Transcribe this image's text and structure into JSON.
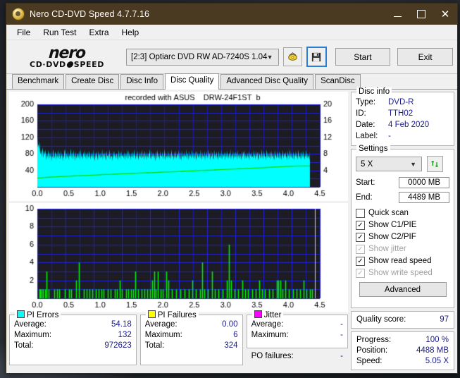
{
  "window": {
    "title": "Nero CD-DVD Speed 4.7.7.16",
    "icon": "nero-disc-icon",
    "minimize": "minimize-icon",
    "maximize": "maximize-icon",
    "close": "close-icon",
    "titlebar_color": "#4b3a22"
  },
  "menu": [
    "File",
    "Run Test",
    "Extra",
    "Help"
  ],
  "logo": {
    "line1": "nero",
    "line2a": "CD·DVD",
    "line2b": "SPEED"
  },
  "toolbar": {
    "drive": "[2:3]   Optiarc DVD RW AD-7240S 1.04",
    "eject_icon": "eject-disc-icon",
    "save_icon": "save-floppy-icon",
    "start_label": "Start",
    "exit_label": "Exit"
  },
  "tabs": [
    {
      "label": "Benchmark",
      "active": false
    },
    {
      "label": "Create Disc",
      "active": false
    },
    {
      "label": "Disc Info",
      "active": false
    },
    {
      "label": "Disc Quality",
      "active": true
    },
    {
      "label": "Advanced Disc Quality",
      "active": false
    },
    {
      "label": "ScanDisc",
      "active": false
    }
  ],
  "disc_info": {
    "legend": "Disc info",
    "rows": [
      {
        "key": "Type:",
        "value": "DVD-R"
      },
      {
        "key": "ID:",
        "value": "TTH02"
      },
      {
        "key": "Date:",
        "value": "4 Feb 2020"
      },
      {
        "key": "Label:",
        "value": "-"
      }
    ]
  },
  "settings": {
    "legend": "Settings",
    "speed": "5 X",
    "refresh_icon": "refresh-icon",
    "start_label": "Start:",
    "start_value": "0000 MB",
    "end_label": "End:",
    "end_value": "4489 MB",
    "checks": [
      {
        "label": "Quick scan",
        "checked": false,
        "disabled": false
      },
      {
        "label": "Show C1/PIE",
        "checked": true,
        "disabled": false
      },
      {
        "label": "Show C2/PIF",
        "checked": true,
        "disabled": false
      },
      {
        "label": "Show jitter",
        "checked": true,
        "disabled": true
      },
      {
        "label": "Show read speed",
        "checked": true,
        "disabled": false
      },
      {
        "label": "Show write speed",
        "checked": true,
        "disabled": true
      }
    ],
    "advanced_label": "Advanced"
  },
  "quality": {
    "label": "Quality score:",
    "value": "97"
  },
  "progress": {
    "rows": [
      {
        "key": "Progress:",
        "value": "100 %"
      },
      {
        "key": "Position:",
        "value": "4488 MB"
      },
      {
        "key": "Speed:",
        "value": "5.05 X"
      }
    ]
  },
  "stats": {
    "pi_errors": {
      "legend": "PI Errors",
      "color": "#00ffff",
      "rows": [
        {
          "key": "Average:",
          "value": "54.18"
        },
        {
          "key": "Maximum:",
          "value": "132"
        },
        {
          "key": "Total:",
          "value": "972623"
        }
      ]
    },
    "pi_failures": {
      "legend": "PI Failures",
      "color": "#ffff00",
      "rows": [
        {
          "key": "Average:",
          "value": "0.00"
        },
        {
          "key": "Maximum:",
          "value": "6"
        },
        {
          "key": "Total:",
          "value": "324"
        }
      ]
    },
    "jitter": {
      "legend": "Jitter",
      "color": "#ff00ff",
      "rows": [
        {
          "key": "Average:",
          "value": "-"
        },
        {
          "key": "Maximum:",
          "value": "-"
        }
      ],
      "po_label": "PO failures:",
      "po_value": "-"
    }
  },
  "chart_data": [
    {
      "type": "area",
      "name": "pi-errors-chart",
      "title": "recorded with ASUS    DRW-24F1ST  b",
      "xlabel": "",
      "ylabel": "",
      "xlim": [
        0.0,
        4.5
      ],
      "xticks": [
        "0.0",
        "0.5",
        "1.0",
        "1.5",
        "2.0",
        "2.5",
        "3.0",
        "3.5",
        "4.0",
        "4.5"
      ],
      "ylim": [
        0,
        200
      ],
      "yticks": [
        "200",
        "160",
        "120",
        "80",
        "40"
      ],
      "y2lim": [
        0,
        20
      ],
      "y2ticks": [
        "20",
        "16",
        "12",
        "8",
        "4"
      ],
      "grid": true,
      "plot_bg": "#1c1c22",
      "series": [
        {
          "name": "PI Errors",
          "color": "#00ffff",
          "axis": "left",
          "values": [
            120,
            96,
            104,
            92,
            110,
            86,
            78,
            90,
            72,
            84,
            96,
            70,
            80,
            88,
            76,
            92,
            64,
            74,
            82,
            70,
            90,
            78,
            66,
            84,
            72,
            88,
            62,
            76,
            70,
            92,
            80,
            68,
            74,
            86,
            78,
            64,
            82,
            70,
            90,
            76,
            68,
            84,
            72,
            66,
            88,
            74,
            80,
            62,
            78,
            70,
            86,
            92,
            74,
            66,
            82,
            76,
            70,
            88,
            64,
            80,
            72,
            78,
            94,
            68,
            84,
            76,
            66,
            90,
            72,
            80,
            62,
            86,
            74,
            68,
            82,
            78,
            70,
            88,
            76,
            64,
            92,
            70,
            80,
            74,
            66,
            84,
            78,
            72,
            90,
            68,
            76,
            82,
            64,
            86,
            74,
            70,
            88,
            78,
            66,
            80,
            72,
            84,
            76,
            68,
            90,
            74,
            62,
            82,
            70,
            86,
            78,
            72,
            64,
            88,
            76,
            80,
            68,
            84,
            70,
            74,
            92,
            66,
            78,
            82,
            72,
            86,
            70,
            64,
            88,
            76,
            74,
            80,
            68,
            90,
            78,
            66,
            84,
            72,
            76,
            62,
            86,
            70,
            88,
            74,
            80,
            68,
            78,
            82,
            72,
            64,
            90,
            76,
            70,
            84,
            66,
            88,
            74,
            78,
            72,
            80,
            68,
            86,
            64,
            76,
            82,
            70,
            90,
            74,
            66,
            88,
            78,
            72,
            80,
            64,
            84,
            70,
            76,
            86,
            68,
            92,
            74,
            78,
            66,
            82,
            70,
            88,
            76,
            64,
            80,
            72,
            86,
            74,
            68,
            90,
            78,
            70,
            84,
            66,
            76,
            88,
            72,
            80,
            64,
            86,
            74,
            70,
            82,
            78,
            92,
            68,
            76,
            66,
            88,
            72,
            84,
            70,
            80,
            74,
            62,
            86,
            78,
            68,
            90,
            76,
            70,
            82,
            64,
            88,
            74,
            78,
            72,
            86,
            66,
            80,
            70,
            92,
            76,
            64,
            84,
            72,
            78,
            68,
            88,
            74,
            70,
            82,
            76,
            66,
            90,
            78,
            72,
            80,
            64,
            86,
            70,
            74,
            88,
            68,
            76,
            82,
            72,
            90,
            66,
            78,
            84,
            70,
            64,
            88,
            76,
            72,
            80,
            68,
            86,
            74,
            78,
            70,
            92,
            66,
            82,
            76,
            64,
            88,
            72,
            80,
            74,
            68,
            90,
            78,
            70,
            84,
            66,
            76,
            86,
            72,
            64,
            88,
            80,
            74,
            70,
            82,
            78,
            68,
            90,
            76,
            66,
            84,
            72,
            78,
            70,
            88,
            64,
            80,
            74,
            86,
            68,
            76,
            92,
            70,
            82,
            78,
            64,
            88,
            72,
            76,
            84,
            70,
            66,
            90,
            74,
            80,
            68,
            86,
            78,
            72,
            64,
            88,
            76,
            70,
            82,
            74,
            68,
            90,
            66,
            80,
            78,
            72,
            86,
            64,
            76,
            84,
            70,
            88,
            74,
            68,
            78,
            82,
            70,
            92,
            66,
            76,
            80,
            72,
            88,
            64,
            84,
            74,
            70,
            86,
            78,
            66,
            90,
            72,
            80,
            68,
            76,
            82,
            74,
            64,
            88,
            70,
            78,
            86,
            72,
            90,
            66,
            80,
            74,
            68,
            84,
            76,
            70,
            88,
            64,
            82,
            78,
            72,
            86,
            70,
            76,
            68,
            90,
            74,
            80,
            66,
            88,
            72,
            78,
            84,
            70,
            64,
            86,
            76,
            80,
            68,
            74,
            92,
            70,
            82,
            66,
            88,
            78,
            72,
            76,
            64,
            90,
            80,
            68,
            84,
            74,
            70,
            86,
            78,
            66,
            88,
            72,
            76,
            82,
            70,
            64,
            90,
            74,
            80,
            68,
            78,
            86,
            72,
            70,
            88,
            66,
            84,
            76,
            64,
            80,
            74,
            90,
            68,
            78,
            82,
            72,
            86,
            70,
            76,
            64,
            88,
            74,
            80,
            66,
            92,
            78,
            70,
            84,
            72,
            68,
            86,
            76,
            64,
            80,
            74,
            88,
            70,
            82,
            66,
            78,
            90,
            72,
            76,
            68,
            84,
            64,
            86,
            78,
            70,
            88,
            74,
            66,
            80,
            72,
            90,
            76,
            68,
            82,
            70,
            78,
            64,
            86
          ]
        },
        {
          "name": "Read speed",
          "color": "#00e000",
          "axis": "right",
          "values": [
            2.1,
            2.2,
            2.3,
            2.35,
            2.4,
            2.45,
            2.5,
            2.55,
            2.6,
            2.65,
            2.7,
            2.72,
            2.75,
            2.8,
            2.85,
            2.9,
            2.95,
            3.0,
            3.02,
            3.05,
            3.1,
            3.15,
            3.2,
            3.22,
            3.25,
            3.3,
            3.35,
            3.4,
            3.42,
            3.45,
            3.5,
            3.55,
            3.6,
            3.62,
            3.65,
            3.7,
            3.75,
            3.8,
            3.82,
            3.85,
            3.9,
            3.95,
            4.0,
            4.02,
            4.05,
            4.1,
            4.15,
            4.2,
            4.25,
            4.3,
            4.35,
            4.4,
            4.42,
            4.45,
            4.5,
            4.55,
            4.6,
            4.65,
            4.7,
            4.75,
            4.8,
            4.85,
            4.9,
            4.95,
            5.0,
            5.02,
            5.05,
            5.05,
            5.05,
            5.05
          ]
        }
      ]
    },
    {
      "type": "bar",
      "name": "pi-failures-chart",
      "xlim": [
        0.0,
        4.5
      ],
      "xticks": [
        "0.0",
        "0.5",
        "1.0",
        "1.5",
        "2.0",
        "2.5",
        "3.0",
        "3.5",
        "4.0",
        "4.5"
      ],
      "ylim": [
        0,
        10
      ],
      "yticks": [
        "10",
        "8",
        "6",
        "4",
        "2"
      ],
      "grid": true,
      "plot_bg": "#1c1c22",
      "bar_color": "#00ee00",
      "points": [
        [
          0.03,
          1
        ],
        [
          0.05,
          1
        ],
        [
          0.07,
          1
        ],
        [
          0.09,
          1
        ],
        [
          0.12,
          1
        ],
        [
          0.15,
          3
        ],
        [
          0.18,
          1
        ],
        [
          0.27,
          1
        ],
        [
          0.31,
          1
        ],
        [
          0.35,
          1
        ],
        [
          0.44,
          1
        ],
        [
          0.5,
          1
        ],
        [
          0.54,
          1
        ],
        [
          0.62,
          2
        ],
        [
          0.66,
          4
        ],
        [
          0.74,
          1
        ],
        [
          0.79,
          1
        ],
        [
          0.83,
          1
        ],
        [
          0.87,
          1
        ],
        [
          0.93,
          1
        ],
        [
          0.98,
          1
        ],
        [
          1.02,
          1
        ],
        [
          1.06,
          1
        ],
        [
          1.12,
          1
        ],
        [
          1.17,
          1
        ],
        [
          1.23,
          1
        ],
        [
          1.27,
          1
        ],
        [
          1.31,
          2
        ],
        [
          1.35,
          1
        ],
        [
          1.41,
          1
        ],
        [
          1.45,
          1
        ],
        [
          1.49,
          1
        ],
        [
          1.53,
          1
        ],
        [
          1.56,
          3
        ],
        [
          1.61,
          1
        ],
        [
          1.66,
          1
        ],
        [
          1.71,
          1
        ],
        [
          1.75,
          1
        ],
        [
          1.79,
          1
        ],
        [
          1.83,
          2
        ],
        [
          1.86,
          3
        ],
        [
          1.89,
          1
        ],
        [
          1.92,
          3
        ],
        [
          1.96,
          1
        ],
        [
          2.0,
          1
        ],
        [
          2.05,
          3
        ],
        [
          2.09,
          2
        ],
        [
          2.14,
          1
        ],
        [
          2.21,
          1
        ],
        [
          2.28,
          1
        ],
        [
          2.34,
          1
        ],
        [
          2.41,
          1
        ],
        [
          2.47,
          2
        ],
        [
          2.53,
          1
        ],
        [
          2.59,
          1
        ],
        [
          2.63,
          4
        ],
        [
          2.66,
          1
        ],
        [
          2.72,
          1
        ],
        [
          2.78,
          3
        ],
        [
          2.83,
          1
        ],
        [
          2.88,
          1
        ],
        [
          2.95,
          1
        ],
        [
          3.02,
          2
        ],
        [
          3.05,
          6
        ],
        [
          3.09,
          2
        ],
        [
          3.14,
          1
        ],
        [
          3.2,
          1
        ],
        [
          3.26,
          2
        ],
        [
          3.31,
          1
        ],
        [
          3.36,
          1
        ],
        [
          3.42,
          1
        ],
        [
          3.48,
          1
        ],
        [
          3.53,
          2
        ],
        [
          3.58,
          1
        ],
        [
          3.63,
          1
        ],
        [
          3.69,
          1
        ],
        [
          3.75,
          1
        ],
        [
          3.81,
          2
        ],
        [
          3.84,
          2
        ],
        [
          3.87,
          2
        ],
        [
          3.9,
          1
        ],
        [
          3.95,
          2
        ],
        [
          4.01,
          1
        ],
        [
          4.07,
          1
        ],
        [
          4.13,
          1
        ],
        [
          4.19,
          1
        ],
        [
          4.24,
          2
        ],
        [
          4.29,
          1
        ],
        [
          4.34,
          1
        ],
        [
          4.38,
          1
        ]
      ]
    }
  ]
}
